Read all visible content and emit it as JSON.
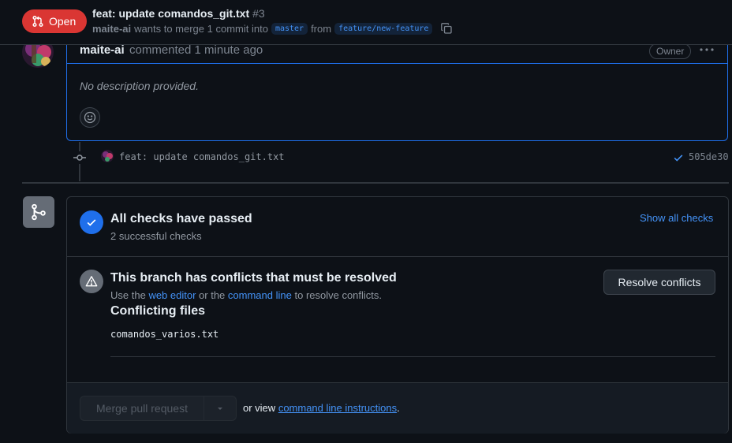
{
  "header": {
    "state_label": "Open",
    "title": "feat: update comandos_git.txt",
    "number": "#3",
    "author": "maite-ai",
    "merge_text": "wants to merge 1 commit into",
    "base_branch": "master",
    "from_text": "from",
    "head_branch": "feature/new-feature"
  },
  "comment": {
    "author": "maite-ai",
    "action": "commented 1 minute ago",
    "role_label": "Owner",
    "body": "No description provided."
  },
  "commit": {
    "message": "feat: update comandos_git.txt",
    "sha": "505de30"
  },
  "checks": {
    "title": "All checks have passed",
    "subtitle": "2 successful checks",
    "show_all_label": "Show all checks"
  },
  "conflicts": {
    "title": "This branch has conflicts that must be resolved",
    "sub_prefix": "Use the",
    "web_editor_link": "web editor",
    "sub_middle": "or the",
    "command_line_link": "command line",
    "sub_suffix": "to resolve conflicts.",
    "files_title": "Conflicting files",
    "files": [
      "comandos_varios.txt"
    ],
    "resolve_button": "Resolve conflicts"
  },
  "merge": {
    "button_label": "Merge pull request",
    "or_view_text": "or view",
    "instructions_link": "command line instructions",
    "period": "."
  },
  "colors": {
    "closed_badge": "#da3633",
    "accent_blue": "#4493f8",
    "border": "#30363d",
    "background": "#0d1117"
  }
}
